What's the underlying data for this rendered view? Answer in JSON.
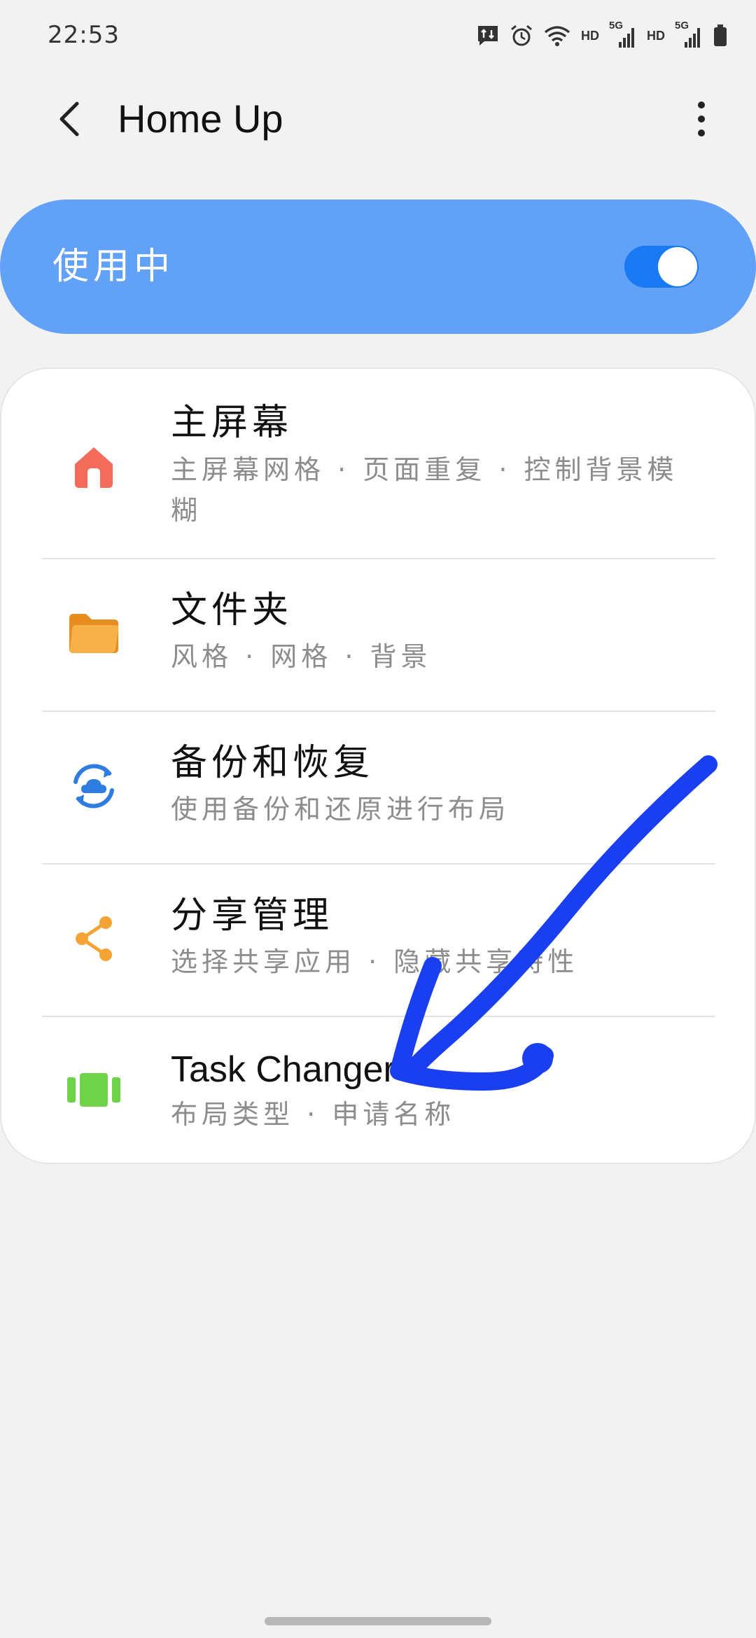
{
  "status_bar": {
    "time": "22:53",
    "network_labels": [
      "HD",
      "HD"
    ],
    "signal_labels": [
      "5G",
      "5G"
    ]
  },
  "app_bar": {
    "title": "Home Up"
  },
  "master_switch": {
    "label": "使用中",
    "enabled": true,
    "color": "#62a1f8",
    "toggle_color": "#1a7af4"
  },
  "settings": {
    "items": [
      {
        "title": "主屏幕",
        "subtitle": "主屏幕网格 · 页面重复 · 控制背景模糊",
        "icon": "home-icon",
        "color": "#f26b5b"
      },
      {
        "title": "文件夹",
        "subtitle": "风格 · 网格 · 背景",
        "icon": "folder-icon",
        "color": "#f6a335"
      },
      {
        "title": "备份和恢复",
        "subtitle": "使用备份和还原进行布局",
        "icon": "cloud-sync-icon",
        "color": "#2f7de1"
      },
      {
        "title": "分享管理",
        "subtitle": "选择共享应用 · 隐藏共享特性",
        "icon": "share-icon",
        "color": "#f6a335"
      },
      {
        "title": "Task Changer",
        "subtitle": "布局类型 · 申请名称",
        "icon": "task-changer-icon",
        "color": "#6fd34a"
      }
    ]
  },
  "annotation": {
    "color": "#1a3ff0",
    "icon": "hand-drawn-arrow"
  }
}
